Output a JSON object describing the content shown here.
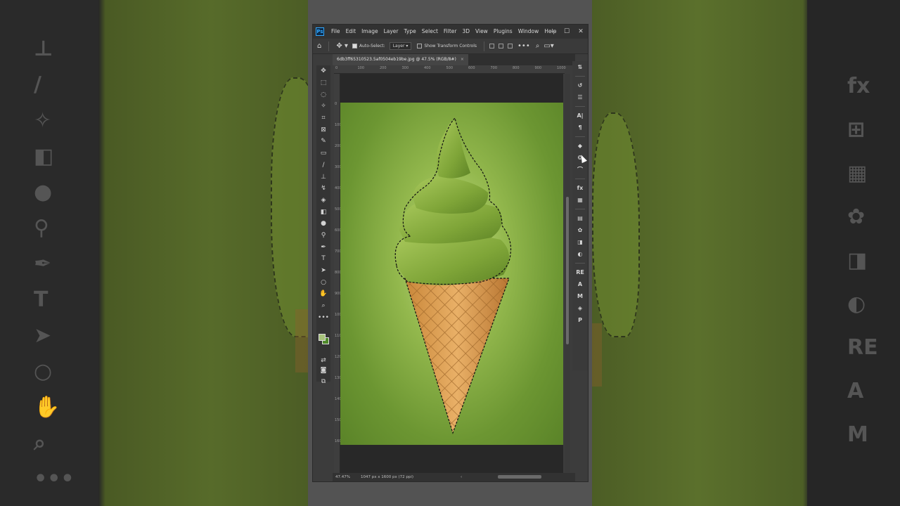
{
  "app": {
    "logo_text": "Ps",
    "menu": [
      "File",
      "Edit",
      "Image",
      "Layer",
      "Type",
      "Select",
      "Filter",
      "3D",
      "View",
      "Plugins",
      "Window",
      "Help"
    ],
    "window_controls": [
      "—",
      "☐",
      "✕"
    ]
  },
  "options_bar": {
    "auto_select_label": "Auto-Select:",
    "auto_select_checked": true,
    "auto_select_target": "Layer",
    "show_transform_label": "Show Transform Controls",
    "show_transform_checked": false
  },
  "document": {
    "tab_title": "6db3ff65310523.5af0504eb19be.jpg @ 47.5% (RGB/8#)",
    "tab_close": "×"
  },
  "rulers": {
    "top": [
      "0",
      "100",
      "200",
      "300",
      "400",
      "500",
      "600",
      "700",
      "800",
      "900",
      "1000"
    ],
    "left": [
      "0",
      "100",
      "200",
      "300",
      "400",
      "500",
      "600",
      "700",
      "800",
      "900",
      "1000",
      "1100",
      "1200",
      "1300",
      "1400",
      "1500",
      "1600"
    ]
  },
  "status": {
    "zoom": "47.47%",
    "dimensions": "1047 px x 1600 px (72 ppi)"
  },
  "colors": {
    "foreground": "#a7c27a",
    "background": "#4f8a2a",
    "accent": "#31a8ff"
  },
  "toolbox": [
    {
      "name": "move-tool-icon",
      "glyph": "✥"
    },
    {
      "name": "marquee-tool-icon",
      "glyph": "⬚"
    },
    {
      "name": "lasso-tool-icon",
      "glyph": "◌"
    },
    {
      "name": "magic-wand-tool-icon",
      "glyph": "✧"
    },
    {
      "name": "crop-tool-icon",
      "glyph": "⌗"
    },
    {
      "name": "frame-tool-icon",
      "glyph": "⊠"
    },
    {
      "name": "eyedropper-tool-icon",
      "glyph": "✎"
    },
    {
      "name": "healing-brush-tool-icon",
      "glyph": "▭"
    },
    {
      "name": "brush-tool-icon",
      "glyph": "∕"
    },
    {
      "name": "clone-stamp-tool-icon",
      "glyph": "⊥"
    },
    {
      "name": "history-brush-tool-icon",
      "glyph": "↯"
    },
    {
      "name": "eraser-tool-icon",
      "glyph": "◈"
    },
    {
      "name": "gradient-tool-icon",
      "glyph": "◧"
    },
    {
      "name": "blur-tool-icon",
      "glyph": "●"
    },
    {
      "name": "dodge-tool-icon",
      "glyph": "⚲"
    },
    {
      "name": "pen-tool-icon",
      "glyph": "✒"
    },
    {
      "name": "type-tool-icon",
      "glyph": "T"
    },
    {
      "name": "path-selection-tool-icon",
      "glyph": "➤"
    },
    {
      "name": "ellipse-tool-icon",
      "glyph": "○"
    },
    {
      "name": "hand-tool-icon",
      "glyph": "✋"
    },
    {
      "name": "zoom-tool-icon",
      "glyph": "⌕"
    },
    {
      "name": "more-tools-icon",
      "glyph": "•••"
    }
  ],
  "panel_icons": [
    {
      "name": "properties-panel-icon",
      "glyph": "⇅"
    },
    {
      "name": "history-panel-icon",
      "glyph": "↺"
    },
    {
      "name": "adjustments-panel-icon",
      "glyph": "☰"
    },
    {
      "name": "character-panel-icon",
      "glyph": "A|"
    },
    {
      "name": "paragraph-panel-icon",
      "glyph": "¶"
    },
    {
      "name": "layers-panel-icon",
      "glyph": "◆"
    },
    {
      "name": "channels-panel-icon",
      "glyph": "❂"
    },
    {
      "name": "paths-panel-icon",
      "glyph": "⌒"
    },
    {
      "name": "styles-panel-icon",
      "glyph": "fx"
    },
    {
      "name": "swatches-panel-icon",
      "glyph": "▦"
    },
    {
      "name": "libraries-panel-icon",
      "glyph": "▤"
    },
    {
      "name": "color-panel-icon",
      "glyph": "✿"
    },
    {
      "name": "gradients-panel-icon",
      "glyph": "◨"
    },
    {
      "name": "patterns-panel-icon",
      "glyph": "◐"
    },
    {
      "name": "re-plugin-icon",
      "glyph": "RE"
    },
    {
      "name": "a-plugin-icon",
      "glyph": "A"
    },
    {
      "name": "m-plugin-icon",
      "glyph": "M"
    },
    {
      "name": "layers-stack-panel-icon",
      "glyph": "◈"
    },
    {
      "name": "plugin-p-icon",
      "glyph": "P"
    }
  ],
  "background_icons_left": [
    "⊥",
    "∕",
    "✧",
    "◧",
    "●",
    "⚲",
    "✒",
    "T",
    "➤",
    "○",
    "✋",
    "⌕",
    "•••"
  ],
  "background_icons_right": [
    "fx",
    "⊞",
    "▦",
    "✿",
    "◨",
    "◐",
    "RE",
    "A",
    "M"
  ]
}
